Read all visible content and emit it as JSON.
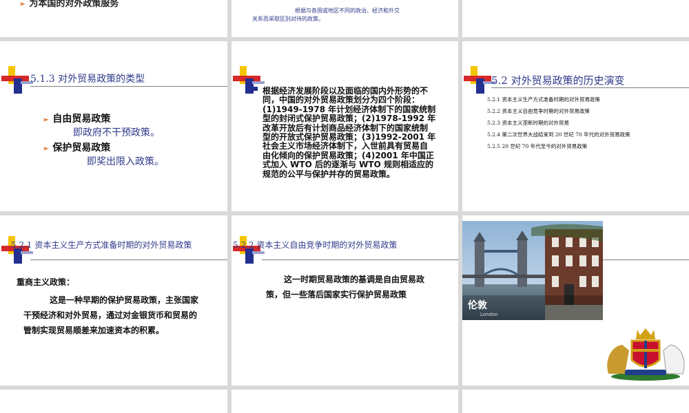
{
  "slide_top_left": {
    "text": "为本国的对外政策服务"
  },
  "slide_top_mid": {
    "line1": "根据与各国或地区不同的政治、经济和外交",
    "line2": "关系而采取区别对待的政策。"
  },
  "slide_1_1": {
    "title": "5.1.3  对外贸易政策的类型",
    "items": [
      {
        "label": "自由贸易政策",
        "desc": "即政府不干预政策。"
      },
      {
        "label": "保护贸易政策",
        "desc": "即奖出限入政策。"
      }
    ]
  },
  "slide_1_2": {
    "lines": [
      "根据经济发展阶段以及面临的国内外形势的不",
      "同，中国的对外贸易政策划分为四个阶段：",
      "(1)1949-1978 年计划经济体制下的国家统制",
      "型的封闭式保护贸易政策；(2)1978-1992 年",
      "改革开放后有计划商品经济体制下的国家统制",
      "型的开放式保护贸易政策；(3)1992-2001 年",
      "社会主义市场经济体制下，入世前具有贸易自",
      "由化倾向的保护贸易政策；(4)2001 年中国正",
      "式加入 WTO 后的逐渐与 WTO 规则相适应的",
      "规范的公平与保护并存的贸易政策。"
    ]
  },
  "slide_1_3": {
    "title": "5.2   对外贸易政策的历史演变",
    "items": [
      "5.2.1   资本主义生产方式准备时期的对外贸易政策",
      "5.2.2   资本主义自由竞争时期的对外贸易政策",
      "5.2.3   资本主义垄断时期的对外贸易",
      "5.2.4   第二次世界大战结束到 20 世纪 70 年代的对外贸易政策",
      "5.2.5   20 世纪 70 年代至今的对外贸易政策"
    ]
  },
  "slide_2_1": {
    "title": "5.2.1   资本主义生产方式准备时期的对外贸易政策",
    "heading": "重商主义政策：",
    "lines": [
      "这是一种早期的保护贸易政策，主张国家",
      "干预经济和对外贸易，通过对金银货币和贸易的",
      "管制实现贸易顺差来加速资本的积累。"
    ]
  },
  "slide_2_2": {
    "title": "5.2.2   资本主义自由竞争时期的对外贸易政策",
    "lines": [
      "这一时期贸易政策的基调是自由贸易政",
      "策，但一些落后国家实行保护贸易政策"
    ]
  },
  "slide_2_3": {
    "photo_caption": "伦敦",
    "photo_caption_en": "London"
  },
  "colors": {
    "title_blue": "#2f3a8a",
    "bullet_orange": "#e06a1a",
    "deco_yellow": "#f5c400",
    "deco_red": "#d62828",
    "deco_blue": "#23308f"
  },
  "icons": [
    "corner-decoration-icon",
    "royal-coat-of-arms-icon",
    "arrow-bullet-icon"
  ]
}
